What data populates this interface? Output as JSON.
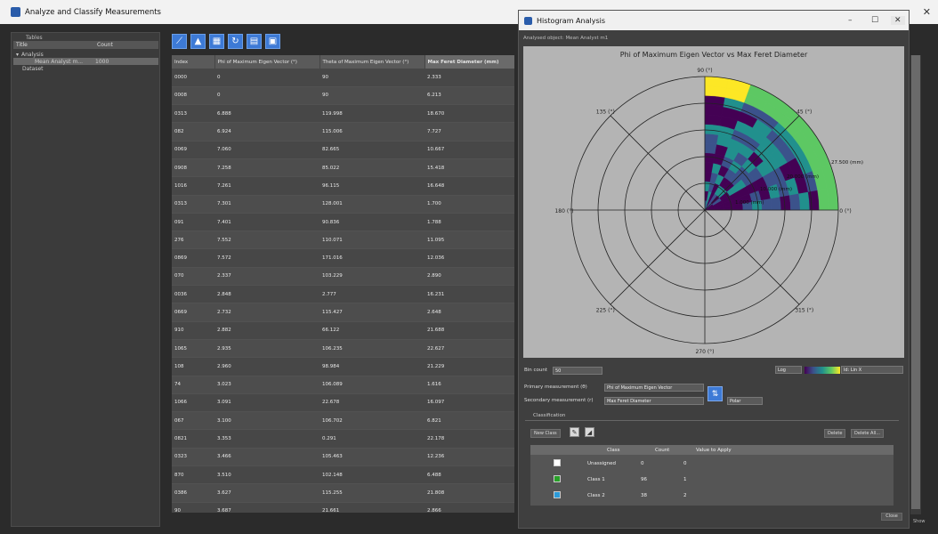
{
  "app": {
    "title": "Analyze and Classify Measurements"
  },
  "left_panel": {
    "label": "Tables",
    "col_title": "Title",
    "col_count": "Count",
    "tree": [
      {
        "label": "Analysis",
        "level": 0
      },
      {
        "label": "Mean Analyst m...",
        "count": "1000",
        "level": 2,
        "selected": true
      },
      {
        "label": "Dataset",
        "level": 1
      }
    ]
  },
  "toolbar": {
    "buttons": [
      "export-icon",
      "chart-icon",
      "columns-icon",
      "refresh-icon",
      "table-icon",
      "document-icon"
    ]
  },
  "table": {
    "columns": [
      "Index",
      "Phi of Maximum Eigen Vector (°)",
      "Theta of Maximum Eigen Vector (°)",
      "Max Feret Diameter (mm)"
    ],
    "rows": [
      [
        "0000",
        "0",
        "90",
        "2.333"
      ],
      [
        "0008",
        "0",
        "90",
        "6.213"
      ],
      [
        "0313",
        "6.888",
        "119.998",
        "18.670"
      ],
      [
        "082",
        "6.924",
        "115.006",
        "7.727"
      ],
      [
        "0069",
        "7.060",
        "82.665",
        "10.667"
      ],
      [
        "0908",
        "7.258",
        "85.022",
        "15.418"
      ],
      [
        "1016",
        "7.261",
        "96.115",
        "16.648"
      ],
      [
        "0313",
        "7.301",
        "128.001",
        "1.700"
      ],
      [
        "091",
        "7.401",
        "90.836",
        "1.788"
      ],
      [
        "276",
        "7.552",
        "110.071",
        "11.095"
      ],
      [
        "0869",
        "7.572",
        "171.016",
        "12.036"
      ],
      [
        "070",
        "2.337",
        "103.229",
        "2.890"
      ],
      [
        "0036",
        "2.848",
        "2.777",
        "16.231"
      ],
      [
        "0669",
        "2.732",
        "115.427",
        "2.648"
      ],
      [
        "910",
        "2.882",
        "66.122",
        "21.688"
      ],
      [
        "1065",
        "2.935",
        "106.235",
        "22.627"
      ],
      [
        "108",
        "2.960",
        "98.984",
        "21.229"
      ],
      [
        "74",
        "3.023",
        "106.089",
        "1.616"
      ],
      [
        "1066",
        "3.091",
        "22.678",
        "16.097"
      ],
      [
        "067",
        "3.100",
        "106.702",
        "6.821"
      ],
      [
        "0821",
        "3.353",
        "0.291",
        "22.178"
      ],
      [
        "0323",
        "3.466",
        "105.463",
        "12.236"
      ],
      [
        "870",
        "3.510",
        "102.148",
        "6.488"
      ],
      [
        "0386",
        "3.627",
        "115.255",
        "21.808"
      ],
      [
        "90",
        "3.687",
        "21.661",
        "2.866"
      ],
      [
        "0806",
        "4.001",
        "81.270",
        "7.357"
      ],
      [
        "0325",
        "4.028",
        "11.952",
        "22.275"
      ]
    ]
  },
  "histogram": {
    "title": "Histogram Analysis",
    "subtitle": "Analysed object: Mean Analyst m1",
    "chart_title": "Phi of Maximum Eigen Vector vs Max Feret Diameter",
    "bin_count_label": "Bin count",
    "bin_count": "50",
    "primary_label": "Primary measurement (θ)",
    "primary_value": "Phi of Maximum Eigen Vector",
    "secondary_label": "Secondary measurement (r)",
    "secondary_value": "Max Feret Diameter",
    "scale": "Log",
    "colormap": "ld: Lin X",
    "display_mode": "Polar",
    "classification": {
      "label": "Classification",
      "new_class_btn": "New Class",
      "delete_btn": "Delete",
      "delete_all_btn": "Delete All...",
      "headers": [
        "Class",
        "Count",
        "Value to Apply"
      ],
      "rows": [
        {
          "name": "Unassigned",
          "count": "0",
          "value": "0",
          "color": "#ffffff"
        },
        {
          "name": "Class 1",
          "count": "96",
          "value": "1",
          "color": "#28a028"
        },
        {
          "name": "Class 2",
          "count": "38",
          "value": "2",
          "color": "#2b9ad8"
        }
      ]
    },
    "close_btn": "Close",
    "help": "Show"
  },
  "chart_data": {
    "type": "heatmap",
    "title": "Phi of Maximum Eigen Vector vs Max Feret Diameter",
    "angle_labels": [
      "0 (°)",
      "45 (°)",
      "90 (°)",
      "135 (°)",
      "180 (°)",
      "225 (°)",
      "270 (°)",
      "315 (°)"
    ],
    "radial_labels": [
      "1.000 (mm)",
      "10.000 (mm)",
      "20.000 (mm)",
      "27.500 (mm)"
    ],
    "theta_range_deg": [
      0,
      90
    ],
    "colormap": [
      "#440154",
      "#3b528b",
      "#21908d",
      "#5dc863",
      "#fde725"
    ]
  }
}
